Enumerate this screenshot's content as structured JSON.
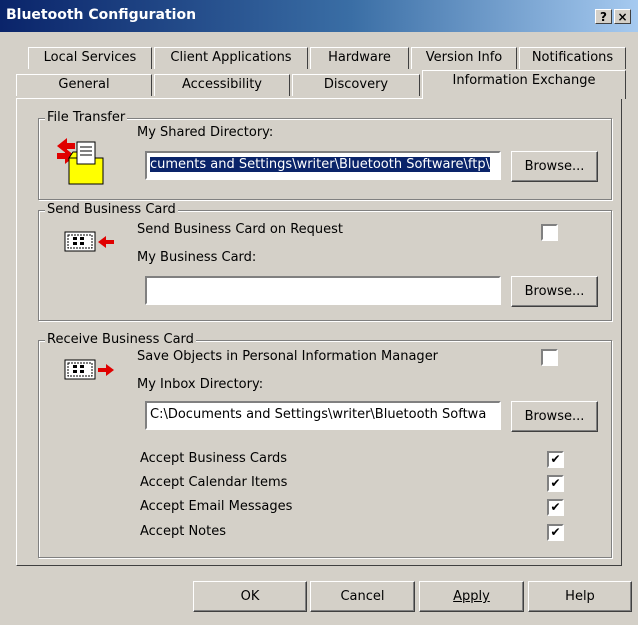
{
  "window": {
    "title": "Bluetooth Configuration",
    "help_glyph": "?",
    "close_glyph": "×"
  },
  "tabs_row1": [
    "Local Services",
    "Client Applications",
    "Hardware",
    "Version Info",
    "Notifications"
  ],
  "tabs_row2": [
    "General",
    "Accessibility",
    "Discovery",
    "Information Exchange"
  ],
  "file_transfer": {
    "group_title": "File Transfer",
    "dir_label": "My Shared Directory:",
    "dir_value": "cuments and Settings\\writer\\Bluetooth Software\\ftp\\",
    "browse": "Browse..."
  },
  "send_card": {
    "group_title": "Send Business Card",
    "request_label": "Send Business Card on Request",
    "request_checked": false,
    "card_label": "My Business Card:",
    "card_value": "",
    "browse": "Browse..."
  },
  "receive_card": {
    "group_title": "Receive Business Card",
    "pim_label": "Save Objects in Personal Information Manager",
    "pim_checked": false,
    "inbox_label": "My Inbox Directory:",
    "inbox_value": "C:\\Documents and Settings\\writer\\Bluetooth Softwa",
    "browse": "Browse...",
    "options": [
      {
        "label": "Accept Business Cards",
        "checked": true
      },
      {
        "label": "Accept Calendar Items",
        "checked": true
      },
      {
        "label": "Accept Email Messages",
        "checked": true
      },
      {
        "label": "Accept Notes",
        "checked": true
      }
    ]
  },
  "footer": {
    "ok": "OK",
    "cancel": "Cancel",
    "apply": "Apply",
    "help": "Help"
  },
  "colors": {
    "face": "#d4d0c8",
    "title_start": "#0a246a",
    "arrow_red": "#e00000",
    "folder_yellow": "#ffff00"
  }
}
